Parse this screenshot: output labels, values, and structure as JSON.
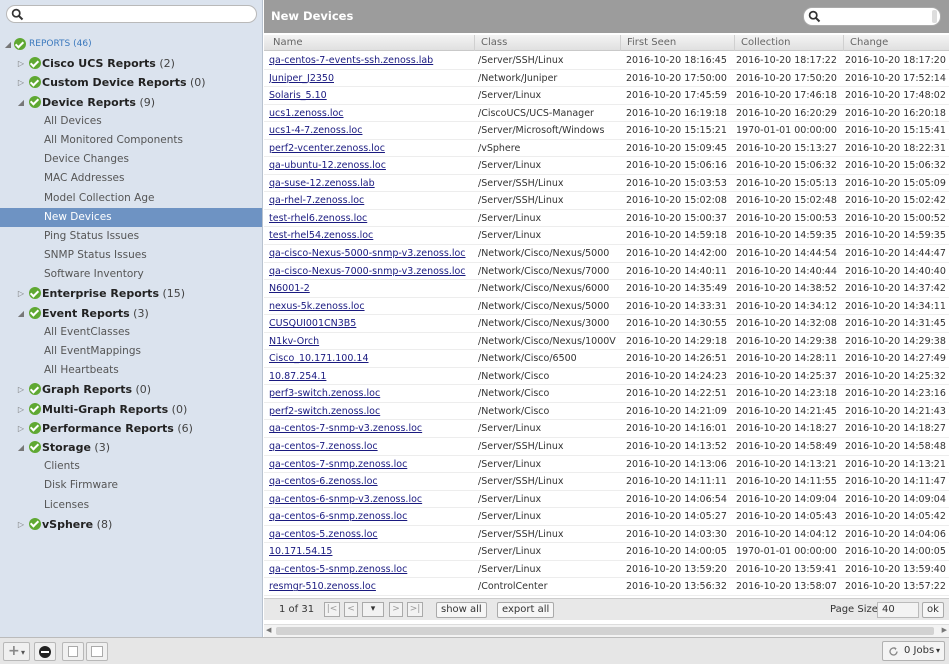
{
  "colors": {
    "tree_bg": "#dbe3ee",
    "tree_selected": "#6e93c3",
    "header_bg": "#9c9c9c",
    "ok_check": "#5fa832",
    "link": "#1a1a80"
  },
  "left_search": {
    "placeholder": ""
  },
  "tree": [
    {
      "level": 0,
      "type": "root",
      "label": "REPORTS (46)",
      "open": true
    },
    {
      "level": 1,
      "type": "group",
      "label": "Cisco UCS Reports",
      "count": "(2)",
      "open": false
    },
    {
      "level": 1,
      "type": "group",
      "label": "Custom Device Reports",
      "count": "(0)",
      "open": false
    },
    {
      "level": 1,
      "type": "group",
      "label": "Device Reports",
      "count": "(9)",
      "open": true
    },
    {
      "level": 2,
      "type": "leaf",
      "label": "All Devices"
    },
    {
      "level": 2,
      "type": "leaf",
      "label": "All Monitored Components"
    },
    {
      "level": 2,
      "type": "leaf",
      "label": "Device Changes"
    },
    {
      "level": 2,
      "type": "leaf",
      "label": "MAC Addresses"
    },
    {
      "level": 2,
      "type": "leaf",
      "label": "Model Collection Age"
    },
    {
      "level": 2,
      "type": "leaf",
      "label": "New Devices",
      "selected": true
    },
    {
      "level": 2,
      "type": "leaf",
      "label": "Ping Status Issues"
    },
    {
      "level": 2,
      "type": "leaf",
      "label": "SNMP Status Issues"
    },
    {
      "level": 2,
      "type": "leaf",
      "label": "Software Inventory"
    },
    {
      "level": 1,
      "type": "group",
      "label": "Enterprise Reports",
      "count": "(15)",
      "open": false
    },
    {
      "level": 1,
      "type": "group",
      "label": "Event Reports",
      "count": "(3)",
      "open": true
    },
    {
      "level": 2,
      "type": "leaf",
      "label": "All EventClasses"
    },
    {
      "level": 2,
      "type": "leaf",
      "label": "All EventMappings"
    },
    {
      "level": 2,
      "type": "leaf",
      "label": "All Heartbeats"
    },
    {
      "level": 1,
      "type": "group",
      "label": "Graph Reports",
      "count": "(0)",
      "open": false
    },
    {
      "level": 1,
      "type": "group",
      "label": "Multi-Graph Reports",
      "count": "(0)",
      "open": false
    },
    {
      "level": 1,
      "type": "group",
      "label": "Performance Reports",
      "count": "(6)",
      "open": false
    },
    {
      "level": 1,
      "type": "group",
      "label": "Storage",
      "count": "(3)",
      "open": true
    },
    {
      "level": 2,
      "type": "leaf",
      "label": "Clients"
    },
    {
      "level": 2,
      "type": "leaf",
      "label": "Disk Firmware"
    },
    {
      "level": 2,
      "type": "leaf",
      "label": "Licenses"
    },
    {
      "level": 1,
      "type": "group",
      "label": "vSphere",
      "count": "(8)",
      "open": false
    }
  ],
  "panel": {
    "title": "New Devices"
  },
  "grid_search": {
    "placeholder": ""
  },
  "columns": [
    "Name",
    "Class",
    "First Seen",
    "Collection",
    "Change"
  ],
  "rows": [
    [
      "qa-centos-7-events-ssh.zenoss.lab",
      "/Server/SSH/Linux",
      "2016-10-20 18:16:45",
      "2016-10-20 18:17:22",
      "2016-10-20 18:17:20"
    ],
    [
      "Juniper_J2350",
      "/Network/Juniper",
      "2016-10-20 17:50:00",
      "2016-10-20 17:50:20",
      "2016-10-20 17:52:14"
    ],
    [
      "Solaris_5.10",
      "/Server/Linux",
      "2016-10-20 17:45:59",
      "2016-10-20 17:46:18",
      "2016-10-20 17:48:02"
    ],
    [
      "ucs1.zenoss.loc",
      "/CiscoUCS/UCS-Manager",
      "2016-10-20 16:19:18",
      "2016-10-20 16:20:29",
      "2016-10-20 16:20:18"
    ],
    [
      "ucs1-4-7.zenoss.loc",
      "/Server/Microsoft/Windows",
      "2016-10-20 15:15:21",
      "1970-01-01 00:00:00",
      "2016-10-20 15:15:41"
    ],
    [
      "perf2-vcenter.zenoss.loc",
      "/vSphere",
      "2016-10-20 15:09:45",
      "2016-10-20 15:13:27",
      "2016-10-20 18:22:31"
    ],
    [
      "qa-ubuntu-12.zenoss.loc",
      "/Server/Linux",
      "2016-10-20 15:06:16",
      "2016-10-20 15:06:32",
      "2016-10-20 15:06:32"
    ],
    [
      "qa-suse-12.zenoss.lab",
      "/Server/SSH/Linux",
      "2016-10-20 15:03:53",
      "2016-10-20 15:05:13",
      "2016-10-20 15:05:09"
    ],
    [
      "qa-rhel-7.zenoss.loc",
      "/Server/SSH/Linux",
      "2016-10-20 15:02:08",
      "2016-10-20 15:02:48",
      "2016-10-20 15:02:42"
    ],
    [
      "test-rhel6.zenoss.loc",
      "/Server/Linux",
      "2016-10-20 15:00:37",
      "2016-10-20 15:00:53",
      "2016-10-20 15:00:52"
    ],
    [
      "test-rhel54.zenoss.loc",
      "/Server/Linux",
      "2016-10-20 14:59:18",
      "2016-10-20 14:59:35",
      "2016-10-20 14:59:35"
    ],
    [
      "qa-cisco-Nexus-5000-snmp-v3.zenoss.loc",
      "/Network/Cisco/Nexus/5000",
      "2016-10-20 14:42:00",
      "2016-10-20 14:44:54",
      "2016-10-20 14:44:47"
    ],
    [
      "qa-cisco-Nexus-7000-snmp-v3.zenoss.loc",
      "/Network/Cisco/Nexus/7000",
      "2016-10-20 14:40:11",
      "2016-10-20 14:40:44",
      "2016-10-20 14:40:40"
    ],
    [
      "N6001-2",
      "/Network/Cisco/Nexus/6000",
      "2016-10-20 14:35:49",
      "2016-10-20 14:38:52",
      "2016-10-20 14:37:42"
    ],
    [
      "nexus-5k.zenoss.loc",
      "/Network/Cisco/Nexus/5000",
      "2016-10-20 14:33:31",
      "2016-10-20 14:34:12",
      "2016-10-20 14:34:11"
    ],
    [
      "CUSQUI001CN3B5",
      "/Network/Cisco/Nexus/3000",
      "2016-10-20 14:30:55",
      "2016-10-20 14:32:08",
      "2016-10-20 14:31:45"
    ],
    [
      "N1kv-Orch",
      "/Network/Cisco/Nexus/1000V",
      "2016-10-20 14:29:18",
      "2016-10-20 14:29:38",
      "2016-10-20 14:29:38"
    ],
    [
      "Cisco_10.171.100.14",
      "/Network/Cisco/6500",
      "2016-10-20 14:26:51",
      "2016-10-20 14:28:11",
      "2016-10-20 14:27:49"
    ],
    [
      "10.87.254.1",
      "/Network/Cisco",
      "2016-10-20 14:24:23",
      "2016-10-20 14:25:37",
      "2016-10-20 14:25:32"
    ],
    [
      "perf3-switch.zenoss.loc",
      "/Network/Cisco",
      "2016-10-20 14:22:51",
      "2016-10-20 14:23:18",
      "2016-10-20 14:23:16"
    ],
    [
      "perf2-switch.zenoss.loc",
      "/Network/Cisco",
      "2016-10-20 14:21:09",
      "2016-10-20 14:21:45",
      "2016-10-20 14:21:43"
    ],
    [
      "qa-centos-7-snmp-v3.zenoss.loc",
      "/Server/Linux",
      "2016-10-20 14:16:01",
      "2016-10-20 14:18:27",
      "2016-10-20 14:18:27"
    ],
    [
      "qa-centos-7.zenoss.loc",
      "/Server/SSH/Linux",
      "2016-10-20 14:13:52",
      "2016-10-20 14:58:49",
      "2016-10-20 14:58:48"
    ],
    [
      "qa-centos-7-snmp.zenoss.loc",
      "/Server/Linux",
      "2016-10-20 14:13:06",
      "2016-10-20 14:13:21",
      "2016-10-20 14:13:21"
    ],
    [
      "qa-centos-6.zenoss.loc",
      "/Server/SSH/Linux",
      "2016-10-20 14:11:11",
      "2016-10-20 14:11:55",
      "2016-10-20 14:11:47"
    ],
    [
      "qa-centos-6-snmp-v3.zenoss.loc",
      "/Server/Linux",
      "2016-10-20 14:06:54",
      "2016-10-20 14:09:04",
      "2016-10-20 14:09:04"
    ],
    [
      "qa-centos-6-snmp.zenoss.loc",
      "/Server/Linux",
      "2016-10-20 14:05:27",
      "2016-10-20 14:05:43",
      "2016-10-20 14:05:42"
    ],
    [
      "qa-centos-5.zenoss.loc",
      "/Server/SSH/Linux",
      "2016-10-20 14:03:30",
      "2016-10-20 14:04:12",
      "2016-10-20 14:04:06"
    ],
    [
      "10.171.54.15",
      "/Server/Linux",
      "2016-10-20 14:00:05",
      "1970-01-01 00:00:00",
      "2016-10-20 14:00:05"
    ],
    [
      "qa-centos-5-snmp.zenoss.loc",
      "/Server/Linux",
      "2016-10-20 13:59:20",
      "2016-10-20 13:59:41",
      "2016-10-20 13:59:40"
    ],
    [
      "resmgr-510.zenoss.loc",
      "/ControlCenter",
      "2016-10-20 13:56:32",
      "2016-10-20 13:58:07",
      "2016-10-20 13:57:22"
    ]
  ],
  "pager": {
    "info": "1 of 31",
    "first": "|<",
    "prev": "<",
    "page_select": "▾",
    "next": ">",
    "last": ">|",
    "show_all": "show all",
    "export_all": "export all",
    "page_size_label": "Page Size",
    "page_size_value": "40",
    "ok": "ok"
  },
  "bottom": {
    "add": "+",
    "add_caret": "▾",
    "jobs_label": "0 Jobs",
    "jobs_caret": "▾"
  }
}
